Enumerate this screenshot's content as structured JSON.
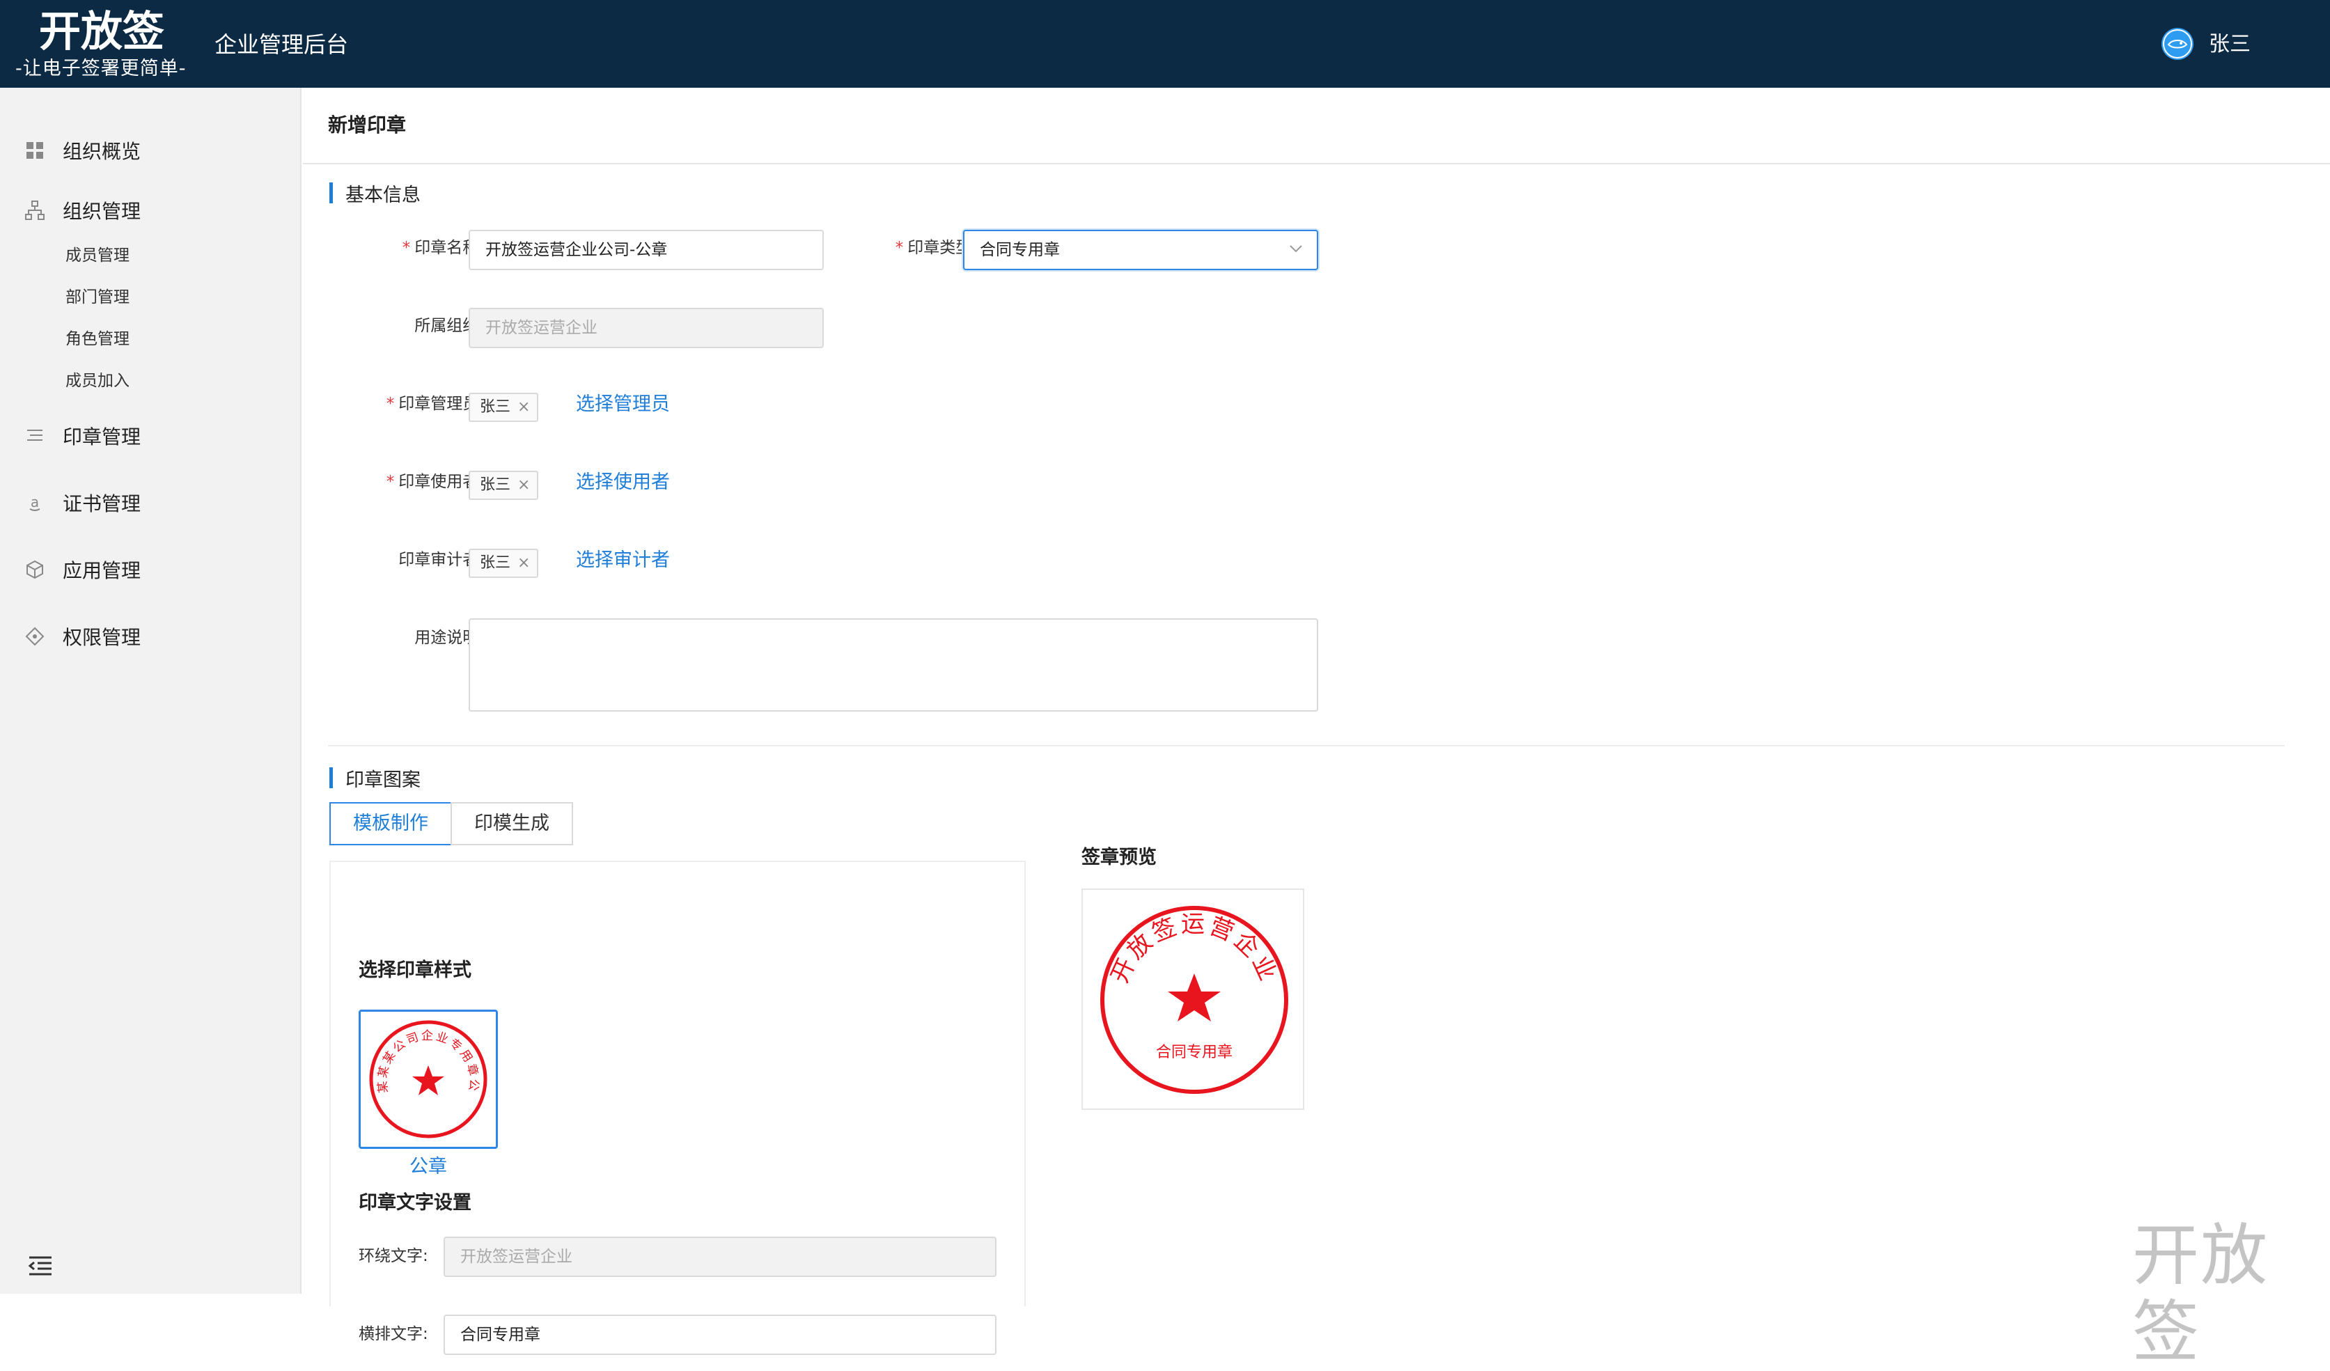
{
  "header": {
    "logo_title": "开放签",
    "logo_slogan": "-让电子签署更简单-",
    "app_title": "企业管理后台",
    "user_name": "张三"
  },
  "sidebar": {
    "items": [
      {
        "label": "组织概览",
        "icon": "grid-icon"
      },
      {
        "label": "组织管理",
        "icon": "org-chart-icon"
      },
      {
        "label": "印章管理",
        "icon": "list-icon"
      },
      {
        "label": "证书管理",
        "icon": "certificate-icon"
      },
      {
        "label": "应用管理",
        "icon": "cube-icon"
      },
      {
        "label": "权限管理",
        "icon": "permission-icon"
      }
    ],
    "sub_items": [
      "成员管理",
      "部门管理",
      "角色管理",
      "成员加入"
    ]
  },
  "page": {
    "title": "新增印章",
    "basic_section": "基本信息",
    "pattern_section": "印章图案"
  },
  "form": {
    "seal_name_label": "印章名称:",
    "seal_name_value": "开放签运营企业公司-公章",
    "seal_type_label": "印章类型:",
    "seal_type_value": "合同专用章",
    "org_label": "所属组织:",
    "org_value": "开放签运营企业",
    "admin_label": "印章管理员:",
    "admin_tag": "张三",
    "admin_link": "选择管理员",
    "user_label": "印章使用者:",
    "user_tag": "张三",
    "user_link": "选择使用者",
    "auditor_label": "印章审计者:",
    "auditor_tag": "张三",
    "auditor_link": "选择审计者",
    "purpose_label": "用途说明:",
    "purpose_value": ""
  },
  "pattern": {
    "tabs": [
      "模板制作",
      "印模生成"
    ],
    "choose_style_title": "选择印章样式",
    "style_name": "公章",
    "style_ring_text": "某某某某公司企业专用章公司",
    "text_settings_title": "印章文字设置",
    "ring_text_label": "环绕文字:",
    "ring_text_value": "开放签运营企业",
    "horizontal_text_label": "横排文字:",
    "horizontal_text_value": "合同专用章"
  },
  "preview": {
    "title": "签章预览",
    "ring_text": "开放签运营企业",
    "center_text": "合同专用章"
  },
  "watermark": "开放签",
  "colors": {
    "header_bg": "#0d2a45",
    "accent": "#1f7ed8",
    "required": "#e4393c",
    "seal_red": "#e8141e"
  }
}
